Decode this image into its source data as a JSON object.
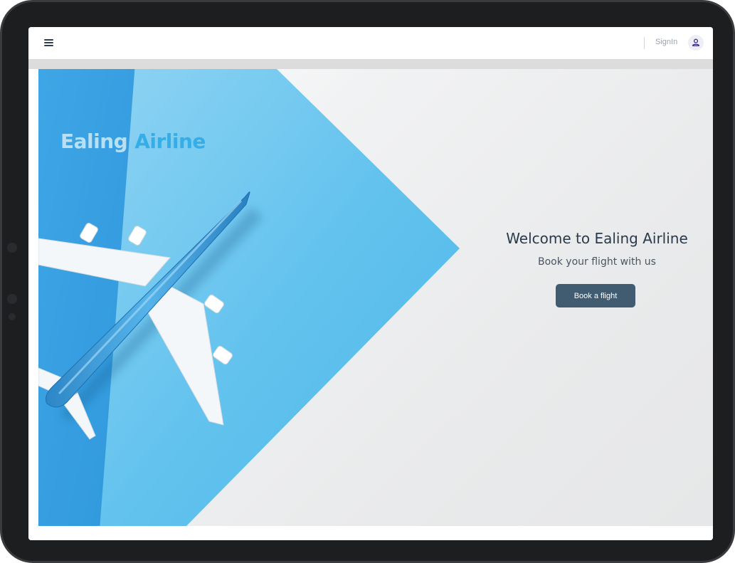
{
  "header": {
    "menu_icon": "hamburger-menu-icon",
    "signin_label": "SignIn",
    "user_icon": "user-icon"
  },
  "hero": {
    "brand_word1": "Ealing",
    "brand_word2": "Airline",
    "title": "Welcome to Ealing Airline",
    "subtitle": "Book your flight with us",
    "cta_label": "Book a flight",
    "image_subject": "model airplane on blue paper"
  },
  "colors": {
    "accent_button": "#415b70",
    "brand_light": "#b9dff3",
    "brand_blue": "#35aee8",
    "paper_blue": "#5cbfea",
    "plane_blue": "#3d9ad6"
  }
}
